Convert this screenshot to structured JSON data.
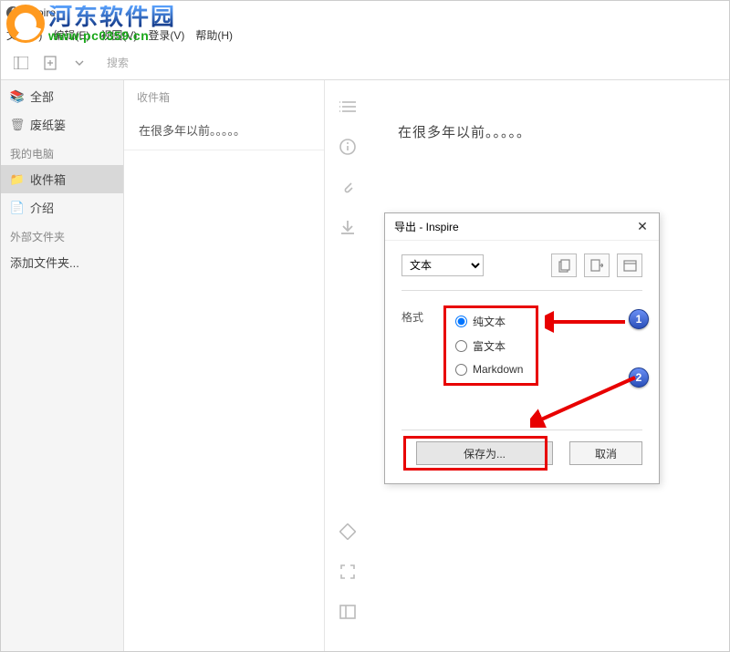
{
  "window": {
    "title": "Inspire"
  },
  "menubar": {
    "file": "文件(F)",
    "edit": "编辑(E)",
    "view": "视图(V)",
    "tools": "登录(V)",
    "help": "帮助(H)"
  },
  "toolbar": {
    "search_placeholder": "搜索"
  },
  "sidebar": {
    "all": "全部",
    "trash": "废纸篓",
    "header_pc": "我的电脑",
    "inbox": "收件箱",
    "intro": "介绍",
    "header_ext": "外部文件夹",
    "add_folder": "添加文件夹..."
  },
  "list": {
    "header": "收件箱",
    "item1": "在很多年以前。。。。。"
  },
  "content": {
    "body": "在很多年以前。。。。。"
  },
  "dialog": {
    "title": "导出 - Inspire",
    "select_value": "文本",
    "format_label": "格式",
    "radio_plain": "纯文本",
    "radio_rich": "富文本",
    "radio_md": "Markdown",
    "save": "保存为...",
    "cancel": "取消"
  },
  "annotations": {
    "b1": "1",
    "b2": "2"
  },
  "watermark": {
    "cn": "河东软件园",
    "url": "www.pc0359.cn"
  }
}
